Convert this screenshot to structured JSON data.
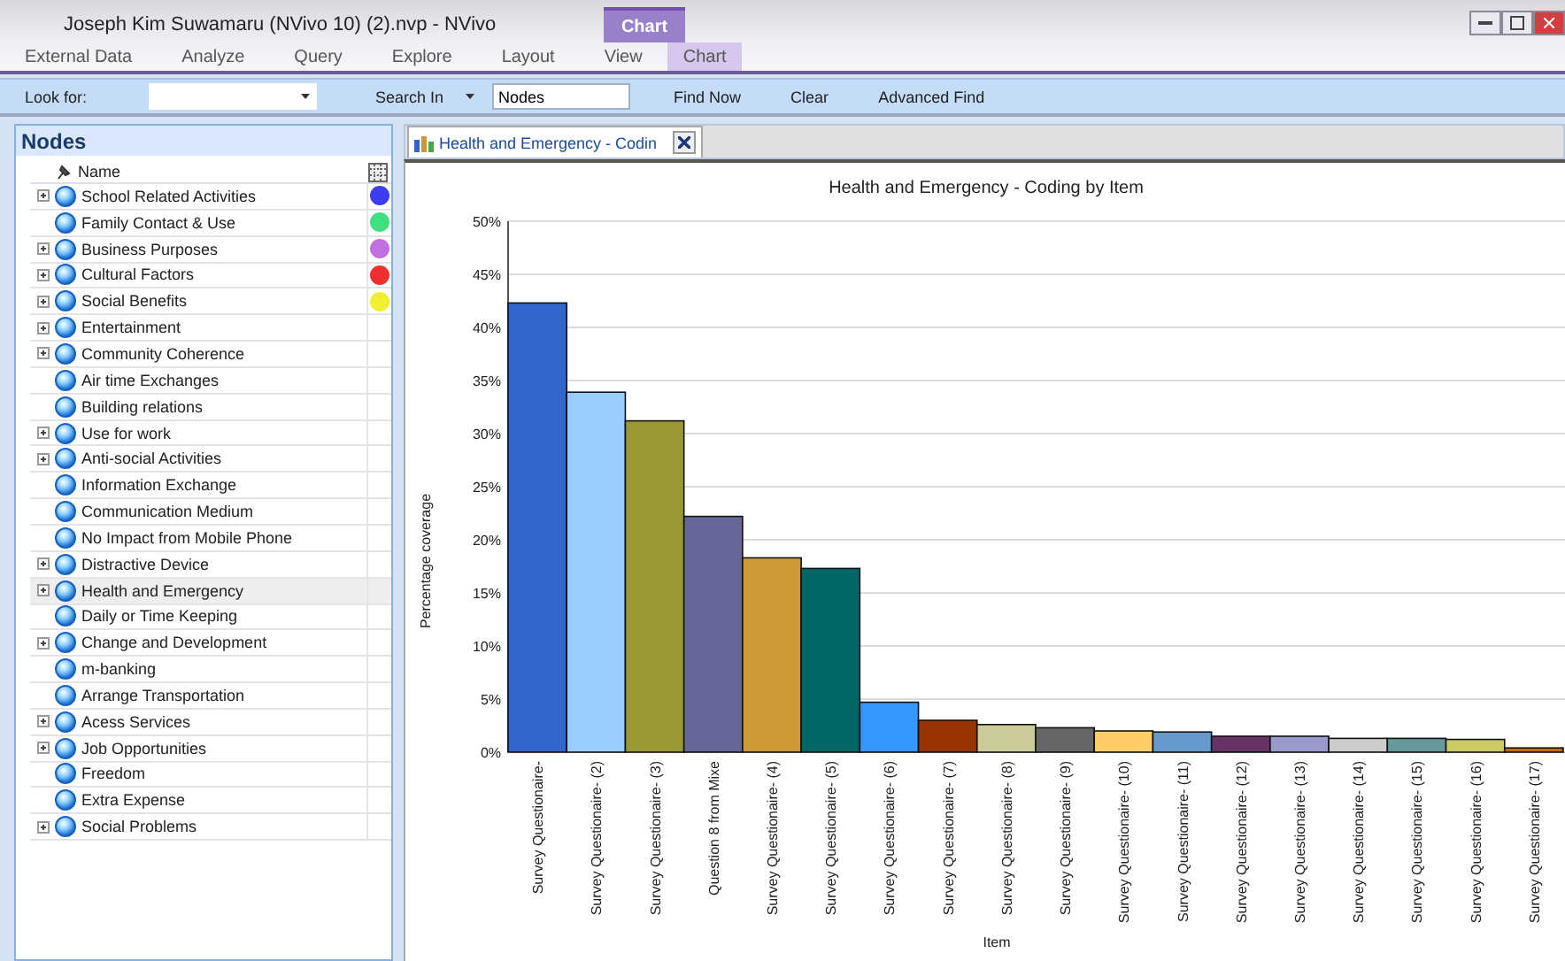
{
  "window": {
    "title": "Joseph Kim Suwamaru (NVivo 10) (2).nvp - NVivo",
    "context_label": "Chart"
  },
  "ribbon_tabs": [
    {
      "label": "External Data",
      "selected": false
    },
    {
      "label": "Analyze",
      "selected": false
    },
    {
      "label": "Query",
      "selected": false
    },
    {
      "label": "Explore",
      "selected": false
    },
    {
      "label": "Layout",
      "selected": false
    },
    {
      "label": "View",
      "selected": false
    },
    {
      "label": "Chart",
      "selected": true
    }
  ],
  "find_bar": {
    "look_for_label": "Look for:",
    "search_in_label": "Search In",
    "search_in_value": "Nodes",
    "buttons": [
      "Find Now",
      "Clear",
      "Advanced Find"
    ]
  },
  "nodes_panel": {
    "title": "Nodes",
    "column": "Name",
    "items": [
      {
        "name": "School Related Activities",
        "expandable": true,
        "color": "#3c3cf0",
        "selected": false
      },
      {
        "name": "Family Contact & Use",
        "expandable": false,
        "color": "#40e080",
        "selected": false
      },
      {
        "name": "Business Purposes",
        "expandable": true,
        "color": "#c070e0",
        "selected": false
      },
      {
        "name": "Cultural Factors",
        "expandable": true,
        "color": "#f03030",
        "selected": false
      },
      {
        "name": "Social Benefits",
        "expandable": true,
        "color": "#f0f030",
        "selected": false
      },
      {
        "name": "Entertainment",
        "expandable": true,
        "selected": false
      },
      {
        "name": "Community Coherence",
        "expandable": true,
        "selected": false
      },
      {
        "name": "Air time Exchanges",
        "expandable": false,
        "selected": false
      },
      {
        "name": "Building relations",
        "expandable": false,
        "selected": false
      },
      {
        "name": "Use for work",
        "expandable": true,
        "selected": false
      },
      {
        "name": "Anti-social Activities",
        "expandable": true,
        "selected": false
      },
      {
        "name": "Information Exchange",
        "expandable": false,
        "selected": false
      },
      {
        "name": "Communication Medium",
        "expandable": false,
        "selected": false
      },
      {
        "name": "No Impact from Mobile Phone",
        "expandable": false,
        "selected": false
      },
      {
        "name": "Distractive Device",
        "expandable": true,
        "selected": false
      },
      {
        "name": "Health and Emergency",
        "expandable": true,
        "selected": true
      },
      {
        "name": "Daily or Time Keeping",
        "expandable": false,
        "selected": false
      },
      {
        "name": "Change and Development",
        "expandable": true,
        "selected": false
      },
      {
        "name": "m-banking",
        "expandable": false,
        "selected": false
      },
      {
        "name": "Arrange Transportation",
        "expandable": false,
        "selected": false
      },
      {
        "name": "Acess Services",
        "expandable": true,
        "selected": false
      },
      {
        "name": "Job Opportunities",
        "expandable": true,
        "selected": false
      },
      {
        "name": "Freedom",
        "expandable": false,
        "selected": false
      },
      {
        "name": "Extra Expense",
        "expandable": false,
        "selected": false
      },
      {
        "name": "Social Problems",
        "expandable": true,
        "selected": false
      }
    ]
  },
  "document_tab": {
    "label": "Health and Emergency - Codin",
    "selected": true
  },
  "chart_data": {
    "type": "bar",
    "title": "Health and Emergency - Coding by Item",
    "xlabel": "Item",
    "ylabel": "Percentage coverage",
    "categories": [
      "Survey Questionaire-",
      "Survey Questionaire- (2)",
      "Survey Questionaire- (3)",
      "Question 8 from Mixe",
      "Survey Questionaire- (4)",
      "Survey Questionaire- (5)",
      "Survey Questionaire- (6)",
      "Survey Questionaire- (7)",
      "Survey Questionaire- (8)",
      "Survey Questionaire- (9)",
      "Survey Questionaire- (10)",
      "Survey Questionaire- (11)",
      "Survey Questionaire- (12)",
      "Survey Questionaire- (13)",
      "Survey Questionaire- (14)",
      "Survey Questionaire- (15)",
      "Survey Questionaire- (16)",
      "Survey Questionaire- (17)"
    ],
    "grid": true,
    "series": [
      {
        "colors": [
          "#3366cc",
          "#99ccff",
          "#999933",
          "#666699",
          "#cc9933",
          "#006666",
          "#3399ff",
          "#993300",
          "#cccc99",
          "#666666",
          "#ffcc66",
          "#6699cc",
          "#663366",
          "#9999cc",
          "#cccccc",
          "#669999",
          "#cccc66",
          "#cc6600"
        ],
        "values": [
          42.3,
          33.9,
          31.2,
          22.2,
          18.3,
          17.3,
          4.7,
          3.0,
          2.6,
          2.3,
          2.0,
          1.9,
          1.5,
          1.5,
          1.3,
          1.3,
          1.2,
          0.4
        ]
      }
    ],
    "ylim": [
      0,
      50
    ],
    "yticks": [
      {
        "value": 0,
        "label": "0%"
      },
      {
        "value": 5,
        "label": "5%"
      },
      {
        "value": 10,
        "label": "10%"
      },
      {
        "value": 15,
        "label": "15%"
      },
      {
        "value": 20,
        "label": "20%"
      },
      {
        "value": 25,
        "label": "25%"
      },
      {
        "value": 30,
        "label": "30%"
      },
      {
        "value": 35,
        "label": "35%"
      },
      {
        "value": 40,
        "label": "40%"
      },
      {
        "value": 45,
        "label": "45%"
      },
      {
        "value": 50,
        "label": "50%"
      }
    ]
  }
}
